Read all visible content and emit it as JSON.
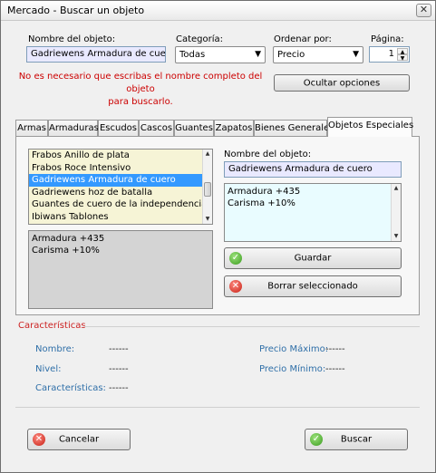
{
  "window": {
    "title": "Mercado - Buscar un objeto",
    "close_glyph": "✕"
  },
  "search": {
    "name_label": "Nombre del objeto:",
    "name_value": "Gadriewens Armadura de cuero",
    "category_label": "Categoría:",
    "category_value": "Todas",
    "order_label": "Ordenar por:",
    "order_value": "Precio",
    "page_label": "Página:",
    "page_value": "1",
    "hint_line1": "No es necesario que escribas el nombre completo del objeto",
    "hint_line2": "para buscarlo.",
    "hide_options_label": "Ocultar opciones"
  },
  "tabs": [
    {
      "label": "Armas"
    },
    {
      "label": "Armaduras"
    },
    {
      "label": "Escudos"
    },
    {
      "label": "Cascos"
    },
    {
      "label": "Guantes"
    },
    {
      "label": "Zapatos"
    },
    {
      "label": "Bienes Generales"
    },
    {
      "label": "Objetos Especiales"
    }
  ],
  "active_tab": "Objetos Especiales",
  "items_list": [
    "Frabos Anillo de plata",
    "Frabos Roce Intensivo",
    "Gadriewens Armadura de cuero",
    "Gadriewens hoz de batalla",
    "Guantes de cuero de la independencia",
    "Ibiwans Tablones"
  ],
  "selected_item": "Gadriewens Armadura de cuero",
  "item_stats": [
    "Armadura +435",
    "Carisma +10%"
  ],
  "editor": {
    "name_label": "Nombre del objeto:",
    "name_value": "Gadriewens Armadura de cuero",
    "stats": [
      "Armadura +435",
      "Carisma +10%"
    ],
    "save_label": "Guardar",
    "delete_label": "Borrar seleccionado"
  },
  "characteristics": {
    "title": "Características",
    "name_label": "Nombre:",
    "name_value": "------",
    "level_label": "Nivel:",
    "level_value": "------",
    "chars_label": "Características:",
    "chars_value": "------",
    "max_price_label": "Precio Máximo:",
    "max_price_value": "------",
    "min_price_label": "Precio Mínimo:",
    "min_price_value": "------"
  },
  "footer": {
    "cancel_label": "Cancelar",
    "search_label": "Buscar"
  },
  "colors": {
    "hint": "#cc0000",
    "selection": "#3399ff",
    "list_bg": "#f6f4d6",
    "input_bg": "#e9e9ff",
    "memo_bg": "#e9fcff",
    "group_title": "#cc2222",
    "field_label": "#2f6fa8"
  }
}
